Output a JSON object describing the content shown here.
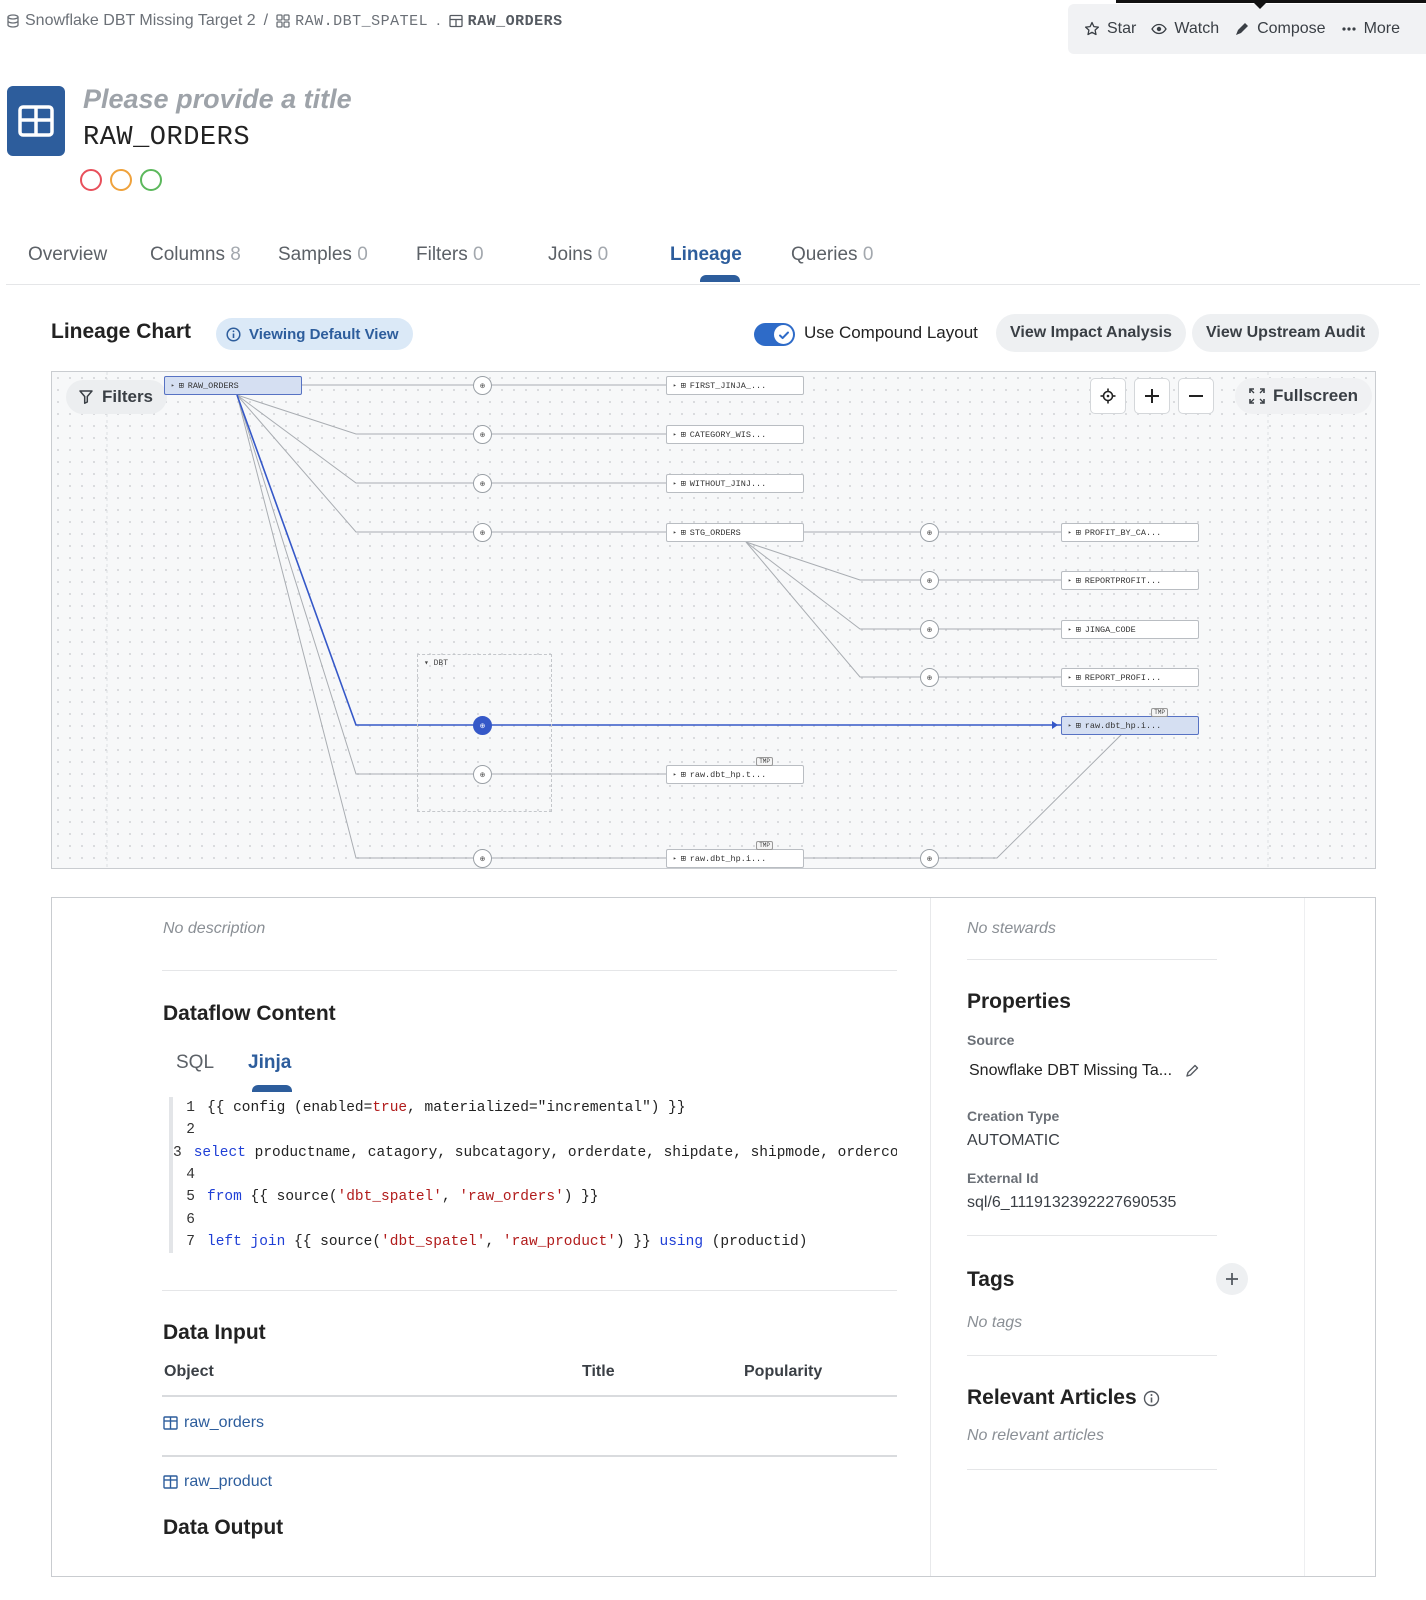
{
  "breadcrumb": {
    "source": "Snowflake DBT Missing Target 2",
    "sep1": "/",
    "schema": "RAW.DBT_SPATEL",
    "sep2": ".",
    "table": "RAW_ORDERS"
  },
  "actions": {
    "star": "Star",
    "watch": "Watch",
    "compose": "Compose",
    "more": "More"
  },
  "header": {
    "title_placeholder": "Please provide a title",
    "name": "RAW_ORDERS",
    "status_colors": [
      "#e8505b",
      "#efa23c",
      "#5cb85c"
    ]
  },
  "tabs": [
    {
      "label": "Overview",
      "count": ""
    },
    {
      "label": "Columns",
      "count": "8"
    },
    {
      "label": "Samples",
      "count": "0"
    },
    {
      "label": "Filters",
      "count": "0"
    },
    {
      "label": "Joins",
      "count": "0"
    },
    {
      "label": "Lineage",
      "count": ""
    },
    {
      "label": "Queries",
      "count": "0"
    }
  ],
  "lineage": {
    "title": "Lineage Chart",
    "view_pill": "Viewing Default View",
    "compound_label": "Use Compound Layout",
    "compound_on": true,
    "impact_button": "View Impact Analysis",
    "upstream_button": "View Upstream Audit",
    "filters_button": "Filters",
    "fullscreen_button": "Fullscreen",
    "group_label": "DBT",
    "tmp_badge": "TMP",
    "nodes": {
      "raw_orders": "RAW_ORDERS",
      "first_jinja": "FIRST_JINJA_...",
      "category_wis": "CATEGORY_WIS...",
      "without_jinj": "WITHOUT_JINJ...",
      "stg_orders": "STG_ORDERS",
      "profit_by_ca": "PROFIT_BY_CA...",
      "reportprofit": "REPORTPROFIT...",
      "jinga_code": "JINGA_CODE",
      "report_profi": "REPORT_PROFI...",
      "raw_dbt_hp_i_sel": "raw.dbt_hp.i...",
      "raw_dbt_hp_t": "raw.dbt_hp.t...",
      "raw_dbt_hp_i": "raw.dbt_hp.i..."
    }
  },
  "details": {
    "no_description": "No description",
    "dataflow_title": "Dataflow Content",
    "code_tabs": {
      "sql": "SQL",
      "jinja": "Jinja"
    },
    "code_lines": [
      {
        "n": "1",
        "t": "{{ config (enabled=true, materialized=\"incremental\") }}"
      },
      {
        "n": "2",
        "t": ""
      },
      {
        "n": "3",
        "t": "select productname, catagory, subcatagory, orderdate, shipdate, shipmode, ordercostprice"
      },
      {
        "n": "4",
        "t": ""
      },
      {
        "n": "5",
        "t": "from {{ source('dbt_spatel', 'raw_orders') }}"
      },
      {
        "n": "6",
        "t": ""
      },
      {
        "n": "7",
        "t": "left join {{ source('dbt_spatel', 'raw_product') }} using (productid)"
      }
    ],
    "data_input_title": "Data Input",
    "columns": {
      "object": "Object",
      "title": "Title",
      "popularity": "Popularity"
    },
    "inputs": [
      "raw_orders",
      "raw_product"
    ],
    "data_output_title": "Data Output"
  },
  "sidebar": {
    "no_stewards": "No stewards",
    "properties_title": "Properties",
    "source_label": "Source",
    "source_value": "Snowflake DBT Missing Ta...",
    "creation_type_label": "Creation Type",
    "creation_type_value": "AUTOMATIC",
    "external_id_label": "External Id",
    "external_id_value": "sql/6_1119132392227690535",
    "tags_title": "Tags",
    "no_tags": "No tags",
    "relevant_title": "Relevant Articles",
    "no_relevant": "No relevant articles"
  }
}
